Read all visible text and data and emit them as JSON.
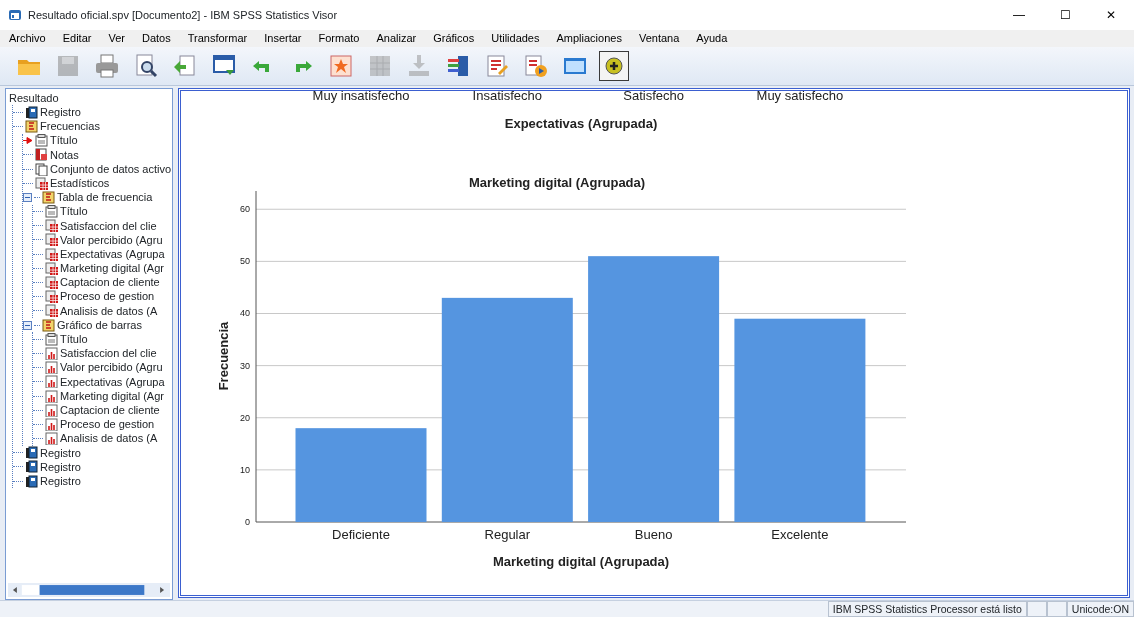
{
  "window": {
    "title": "Resultado oficial.spv [Documento2] - IBM SPSS Statistics Visor",
    "controls": [
      "—",
      "☐",
      "✕"
    ]
  },
  "menu": [
    "Archivo",
    "Editar",
    "Ver",
    "Datos",
    "Transformar",
    "Insertar",
    "Formato",
    "Analizar",
    "Gráficos",
    "Utilidades",
    "Ampliaciones",
    "Ventana",
    "Ayuda"
  ],
  "toolbar": [
    {
      "kind": "folder",
      "disabled": false,
      "pressed": false
    },
    {
      "kind": "save",
      "disabled": true,
      "pressed": false
    },
    {
      "kind": "print",
      "disabled": false,
      "pressed": false
    },
    {
      "kind": "preview",
      "disabled": false,
      "pressed": false
    },
    {
      "kind": "export",
      "disabled": false,
      "pressed": false
    },
    {
      "kind": "goto-data",
      "disabled": false,
      "pressed": false
    },
    {
      "kind": "undo",
      "disabled": false,
      "pressed": false
    },
    {
      "kind": "redo",
      "disabled": false,
      "pressed": false
    },
    {
      "kind": "star",
      "disabled": false,
      "pressed": false
    },
    {
      "kind": "grid",
      "disabled": true,
      "pressed": false
    },
    {
      "kind": "insert",
      "disabled": true,
      "pressed": false
    },
    {
      "kind": "list",
      "disabled": false,
      "pressed": false
    },
    {
      "kind": "edit-text",
      "disabled": false,
      "pressed": false
    },
    {
      "kind": "run",
      "disabled": false,
      "pressed": false
    },
    {
      "kind": "window",
      "disabled": false,
      "pressed": false
    },
    {
      "kind": "add",
      "disabled": false,
      "pressed": true
    }
  ],
  "tree": {
    "root": "Resultado",
    "children": [
      {
        "label": "Registro",
        "kind": "log",
        "marked": false
      },
      {
        "label": "Frecuencias",
        "kind": "proc",
        "marked": false,
        "children": [
          {
            "label": "Título",
            "kind": "title",
            "marked": true
          },
          {
            "label": "Notas",
            "kind": "notes",
            "marked": false
          },
          {
            "label": "Conjunto de datos activo",
            "kind": "dataset",
            "marked": false
          },
          {
            "label": "Estadísticos",
            "kind": "table",
            "marked": false
          },
          {
            "label": "Tabla de frecuencia",
            "kind": "proc",
            "marked": false,
            "expanded": true,
            "children": [
              {
                "label": "Título",
                "kind": "title",
                "marked": false
              },
              {
                "label": "Satisfaccion del clie",
                "kind": "table",
                "marked": false
              },
              {
                "label": "Valor percibido (Agru",
                "kind": "table",
                "marked": false
              },
              {
                "label": "Expectativas (Agrupa",
                "kind": "table",
                "marked": false
              },
              {
                "label": "Marketing digital (Agr",
                "kind": "table",
                "marked": false
              },
              {
                "label": "Captacion de cliente",
                "kind": "table",
                "marked": false
              },
              {
                "label": "Proceso de gestion",
                "kind": "table",
                "marked": false
              },
              {
                "label": "Analisis de datos (A",
                "kind": "table",
                "marked": false
              }
            ]
          },
          {
            "label": "Gráfico de barras",
            "kind": "proc",
            "marked": false,
            "expanded": true,
            "children": [
              {
                "label": "Título",
                "kind": "title",
                "marked": false
              },
              {
                "label": "Satisfaccion del clie",
                "kind": "chart",
                "marked": false
              },
              {
                "label": "Valor percibido (Agru",
                "kind": "chart",
                "marked": false
              },
              {
                "label": "Expectativas (Agrupa",
                "kind": "chart",
                "marked": false
              },
              {
                "label": "Marketing digital (Agr",
                "kind": "chart",
                "marked": false
              },
              {
                "label": "Captacion de cliente",
                "kind": "chart",
                "marked": false
              },
              {
                "label": "Proceso de gestion",
                "kind": "chart",
                "marked": false
              },
              {
                "label": "Analisis de datos (A",
                "kind": "chart",
                "marked": false
              }
            ]
          }
        ]
      },
      {
        "label": "Registro",
        "kind": "log",
        "marked": false
      },
      {
        "label": "Registro",
        "kind": "log",
        "marked": false
      },
      {
        "label": "Registro",
        "kind": "log",
        "marked": false
      }
    ]
  },
  "previous_chart": {
    "categories": [
      "Muy insatisfecho",
      "Insatisfecho",
      "Satisfecho",
      "Muy satisfecho"
    ],
    "xlabel": "Expectativas (Agrupada)"
  },
  "chart": {
    "chart_data": {
      "type": "bar",
      "title": "Marketing digital (Agrupada)",
      "xlabel": "Marketing digital (Agrupada)",
      "ylabel": "Frecuencia",
      "categories": [
        "Deficiente",
        "Regular",
        "Bueno",
        "Excelente"
      ],
      "series": [
        {
          "color": "#5595e0",
          "values": [
            18,
            43,
            51,
            39
          ]
        }
      ],
      "ylim": [
        0,
        63.5
      ],
      "yticks": [
        0,
        10,
        20,
        30,
        40,
        50,
        60
      ],
      "grid": true
    }
  },
  "status_bar": {
    "message": "IBM SPSS Statistics Processor está listo",
    "encoding": "Unicode:ON"
  }
}
